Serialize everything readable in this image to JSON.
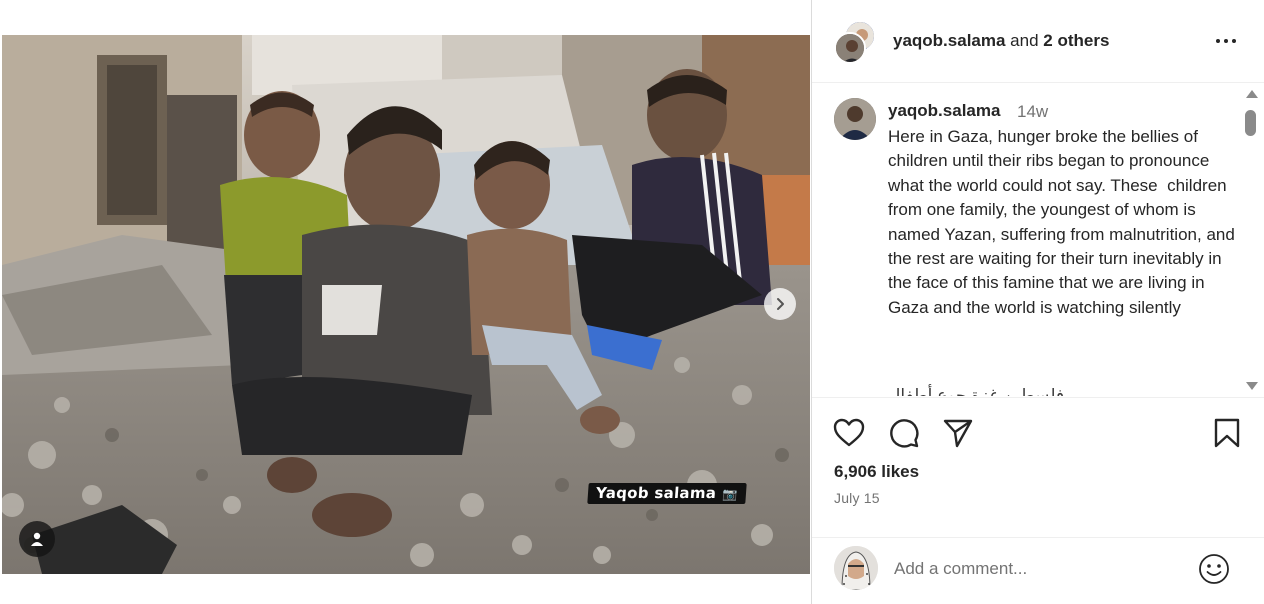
{
  "post": {
    "header": {
      "username": "yaqob.salama",
      "connector": " and ",
      "others": "2 others"
    },
    "caption": {
      "username": "yaqob.salama",
      "time": "14w",
      "text": "Here in Gaza, hunger broke the bellies of children until their ribs began to pronounce what the world could not say. These  children from one family, the youngest of whom is named Yazan, suffering from malnutrition, and the rest are waiting for their turn inevitably in the face of this famine that we are living in Gaza and the world is watching silently",
      "cut_off_line": "فلسطين  غزة  جوع  أطفال"
    },
    "media": {
      "watermark": "Yaqob salama",
      "watermark_icon": "camera-icon"
    },
    "stats": {
      "likes": "6,906 likes",
      "date": "July 15"
    },
    "comment": {
      "placeholder": "Add a comment..."
    },
    "icons": {
      "like": "heart-icon",
      "comment": "comment-bubble-icon",
      "share": "paper-plane-icon",
      "save": "bookmark-icon",
      "more": "more-options-icon",
      "next": "chevron-right-icon",
      "tag": "user-tag-icon",
      "emoji": "emoji-smile-icon"
    },
    "colors": {
      "text": "#262626",
      "secondary": "#737373",
      "divider": "#efefef"
    }
  }
}
